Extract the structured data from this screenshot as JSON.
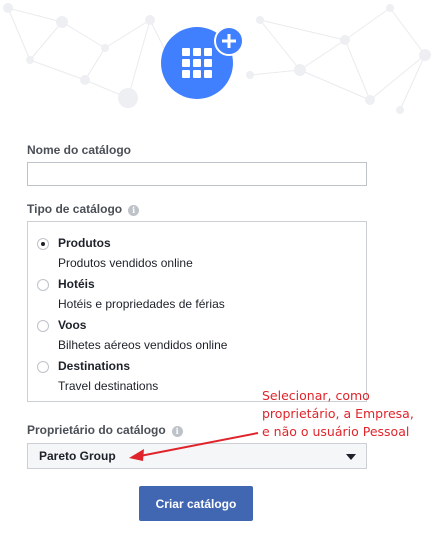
{
  "form": {
    "catalog_name": {
      "label": "Nome do catálogo",
      "value": "",
      "placeholder": ""
    },
    "catalog_type": {
      "label": "Tipo de catálogo",
      "options": [
        {
          "title": "Produtos",
          "description": "Produtos vendidos online",
          "selected": true
        },
        {
          "title": "Hotéis",
          "description": "Hotéis e propriedades de férias",
          "selected": false
        },
        {
          "title": "Voos",
          "description": "Bilhetes aéreos vendidos online",
          "selected": false
        },
        {
          "title": "Destinations",
          "description": "Travel destinations",
          "selected": false
        }
      ]
    },
    "catalog_owner": {
      "label": "Proprietário do catálogo",
      "selected_value": "Pareto Group"
    },
    "submit_label": "Criar catálogo"
  },
  "annotation": {
    "lines": [
      "Selecionar, como",
      "proprietário, a Empresa,",
      "e não o usuário Pessoal"
    ],
    "color": "#e0242b"
  },
  "colors": {
    "accent": "#4080ff",
    "button": "#4267b2",
    "network_lines": "#e4e6eb"
  },
  "icons": {
    "hero": "catalog-grid-icon",
    "hero_badge": "plus-icon",
    "info": "info-icon",
    "caret": "caret-down-icon"
  }
}
